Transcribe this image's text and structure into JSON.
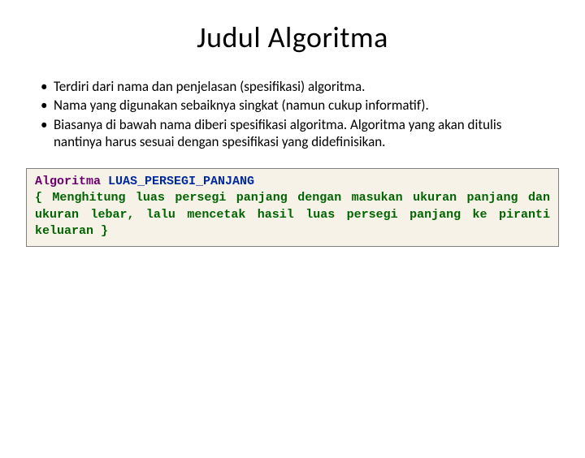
{
  "title": "Judul Algoritma",
  "bullets": [
    "Terdiri dari nama dan penjelasan (spesifikasi) algoritma.",
    "Nama yang digunakan sebaiknya singkat (namun cukup informatif).",
    "Biasanya di bawah nama diberi spesifikasi algoritma. Algoritma yang akan ditulis nantinya harus sesuai dengan spesifikasi yang didefinisikan."
  ],
  "code": {
    "keyword": "Algoritma",
    "name": "LUAS_PERSEGI_PANJANG",
    "comment": "{ Menghitung luas persegi panjang dengan masukan ukuran panjang dan ukuran lebar, lalu mencetak hasil luas persegi panjang ke piranti keluaran }"
  }
}
